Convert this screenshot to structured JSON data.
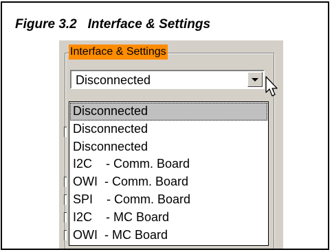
{
  "figure": {
    "caption": "Figure 3.2   Interface & Settings"
  },
  "group": {
    "title": "Interface & Settings"
  },
  "combo": {
    "selected_value": "Disconnected"
  },
  "dropdown": {
    "items": [
      {
        "label": "Disconnected",
        "selected": true
      },
      {
        "label": "Disconnected",
        "selected": false
      },
      {
        "label": "Disconnected",
        "selected": false
      },
      {
        "label": "I2C    - Comm. Board",
        "selected": false
      },
      {
        "label": "OWI  - Comm. Board",
        "selected": false
      },
      {
        "label": "SPI    - Comm. Board",
        "selected": false
      },
      {
        "label": "I2C    - MC Board",
        "selected": false
      },
      {
        "label": "OWI  - MC Board",
        "selected": false
      }
    ]
  },
  "colors": {
    "group_title_highlight": "#ff8c00",
    "panel_background": "#d4d0c8",
    "selected_item_background": "#c0c0c0"
  }
}
